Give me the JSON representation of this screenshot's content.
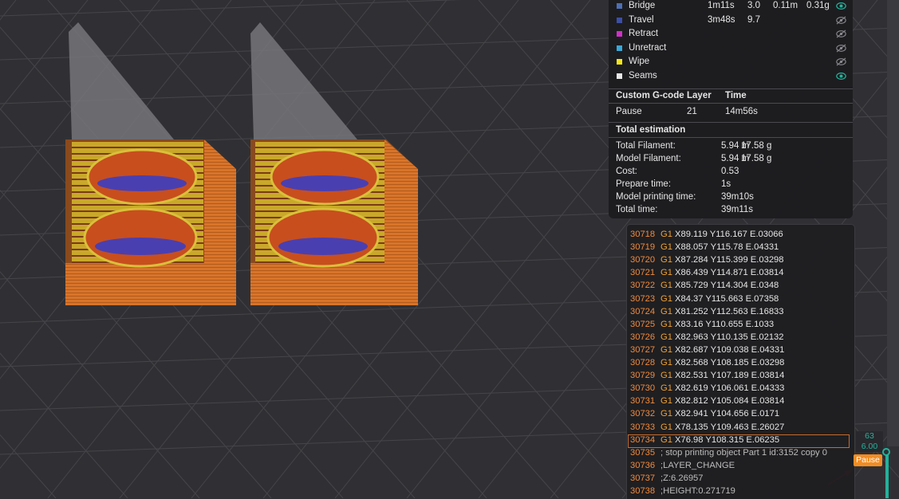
{
  "legend": {
    "rows": [
      {
        "label": "Bridge",
        "color": "#4d6fb3",
        "time": "1m11s",
        "pct": "3.0",
        "used_m": "0.11m",
        "used_g": "0.31g",
        "visible": true
      },
      {
        "label": "Travel",
        "color": "#3b4fa6",
        "time": "3m48s",
        "pct": "9.7",
        "used_m": "",
        "used_g": "",
        "visible": false
      },
      {
        "label": "Retract",
        "color": "#d030c8",
        "time": "",
        "pct": "",
        "used_m": "",
        "used_g": "",
        "visible": false
      },
      {
        "label": "Unretract",
        "color": "#3aa8d8",
        "time": "",
        "pct": "",
        "used_m": "",
        "used_g": "",
        "visible": false
      },
      {
        "label": "Wipe",
        "color": "#f2e61a",
        "time": "",
        "pct": "",
        "used_m": "",
        "used_g": "",
        "visible": false
      },
      {
        "label": "Seams",
        "color": "#e8e8e8",
        "time": "",
        "pct": "",
        "used_m": "",
        "used_g": "",
        "visible": true
      }
    ],
    "custom_gcode": {
      "headers": [
        "Custom G-code",
        "Layer",
        "Time"
      ],
      "row": {
        "name": "Pause",
        "layer": "21",
        "time": "14m56s"
      }
    },
    "total": {
      "title": "Total estimation",
      "items": [
        {
          "k": "Total Filament:",
          "v1": "5.94 m",
          "v2": "17.58 g"
        },
        {
          "k": "Model Filament:",
          "v1": "5.94 m",
          "v2": "17.58 g"
        },
        {
          "k": "Cost:",
          "v1": "0.53",
          "v2": ""
        },
        {
          "k": "Prepare time:",
          "v1": "1s",
          "v2": ""
        },
        {
          "k": "Model printing time:",
          "v1": "39m10s",
          "v2": ""
        },
        {
          "k": "Total time:",
          "v1": "39m11s",
          "v2": ""
        }
      ]
    }
  },
  "gcode": [
    {
      "n": "30718",
      "cmd": "G1",
      "args": "X89.119 Y116.167 E.03066"
    },
    {
      "n": "30719",
      "cmd": "G1",
      "args": "X88.057 Y115.78 E.04331"
    },
    {
      "n": "30720",
      "cmd": "G1",
      "args": "X87.284 Y115.399 E.03298"
    },
    {
      "n": "30721",
      "cmd": "G1",
      "args": "X86.439 Y114.871 E.03814"
    },
    {
      "n": "30722",
      "cmd": "G1",
      "args": "X85.729 Y114.304 E.0348"
    },
    {
      "n": "30723",
      "cmd": "G1",
      "args": "X84.37 Y115.663 E.07358"
    },
    {
      "n": "30724",
      "cmd": "G1",
      "args": "X81.252 Y112.563 E.16833"
    },
    {
      "n": "30725",
      "cmd": "G1",
      "args": "X83.16 Y110.655 E.1033"
    },
    {
      "n": "30726",
      "cmd": "G1",
      "args": "X82.963 Y110.135 E.02132"
    },
    {
      "n": "30727",
      "cmd": "G1",
      "args": "X82.687 Y109.038 E.04331"
    },
    {
      "n": "30728",
      "cmd": "G1",
      "args": "X82.568 Y108.185 E.03298"
    },
    {
      "n": "30729",
      "cmd": "G1",
      "args": "X82.531 Y107.189 E.03814"
    },
    {
      "n": "30730",
      "cmd": "G1",
      "args": "X82.619 Y106.061 E.04333"
    },
    {
      "n": "30731",
      "cmd": "G1",
      "args": "X82.812 Y105.084 E.03814"
    },
    {
      "n": "30732",
      "cmd": "G1",
      "args": "X82.941 Y104.656 E.0171"
    },
    {
      "n": "30733",
      "cmd": "G1",
      "args": "X78.135 Y109.463 E.26027"
    },
    {
      "n": "30734",
      "cmd": "G1",
      "args": "X76.98 Y108.315 E.06235",
      "selected": true
    },
    {
      "n": "30735",
      "cmd": "",
      "args": "; stop printing object Part 1 id:3152 copy 0"
    },
    {
      "n": "30736",
      "cmd": "",
      "args": ";LAYER_CHANGE"
    },
    {
      "n": "30737",
      "cmd": "",
      "args": ";Z:6.26957"
    },
    {
      "n": "30738",
      "cmd": "",
      "args": ";HEIGHT:0.271719"
    }
  ],
  "slider": {
    "layer": "63",
    "height": "6.00",
    "pause_label": "Pause",
    "accent": "#22b39c",
    "pause_color": "#f28d23"
  }
}
